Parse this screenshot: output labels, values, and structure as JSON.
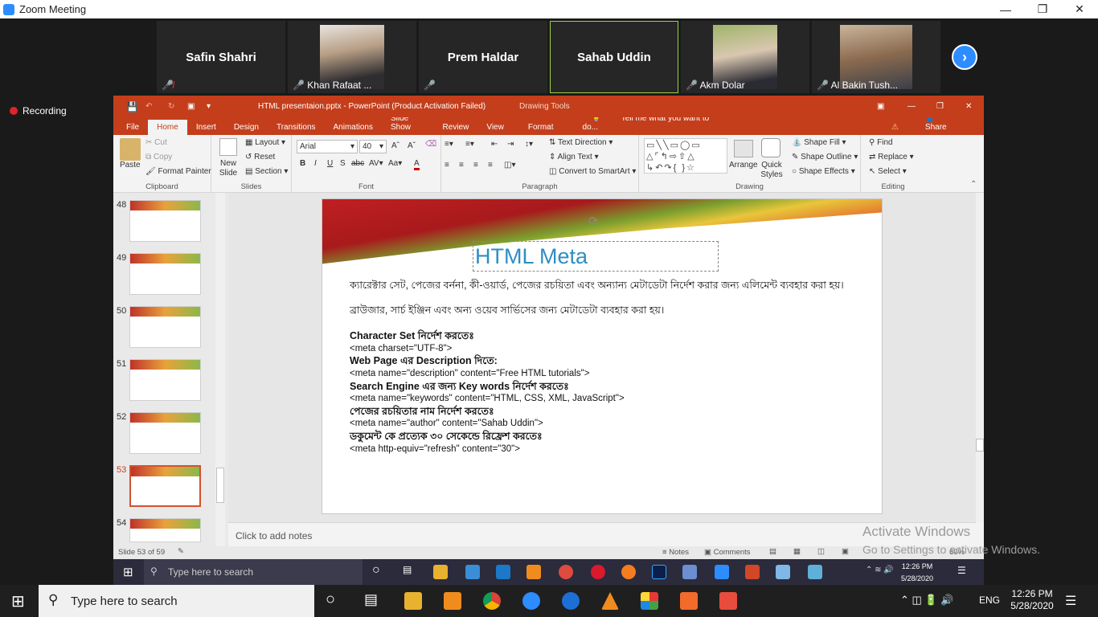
{
  "zoom": {
    "title": "Zoom Meeting",
    "recording": "Recording",
    "next_icon": "chevron-right-icon"
  },
  "participants": [
    {
      "name": "Safin Shahri",
      "video": false
    },
    {
      "name": "Khan Rafaat ...",
      "video": true
    },
    {
      "name": "Prem Haldar",
      "video": false
    },
    {
      "name": "Sahab Uddin",
      "video": false,
      "active": true
    },
    {
      "name": "Akm Dolar",
      "video": true
    },
    {
      "name": "Al Bakin Tush...",
      "video": true
    }
  ],
  "ppt": {
    "title": "HTML presentaion.pptx - PowerPoint (Product Activation Failed)",
    "drawing_tools": "Drawing Tools",
    "tabs": [
      "File",
      "Home",
      "Insert",
      "Design",
      "Transitions",
      "Animations",
      "Slide Show",
      "Review",
      "View",
      "Format"
    ],
    "tell_me": "Tell me what you want to do...",
    "share": "Share",
    "clipboard": {
      "paste": "Paste",
      "cut": "Cut",
      "copy": "Copy",
      "format_painter": "Format Painter",
      "label": "Clipboard"
    },
    "slides_grp": {
      "new_slide": "New Slide",
      "layout": "Layout",
      "reset": "Reset",
      "section": "Section",
      "label": "Slides"
    },
    "font": {
      "name": "Arial",
      "size": "40",
      "label": "Font"
    },
    "paragraph": {
      "text_direction": "Text Direction",
      "align_text": "Align Text",
      "convert": "Convert to SmartArt",
      "label": "Paragraph"
    },
    "drawing": {
      "arrange": "Arrange",
      "quick_styles": "Quick Styles",
      "shape_fill": "Shape Fill",
      "shape_outline": "Shape Outline",
      "shape_effects": "Shape Effects",
      "label": "Drawing"
    },
    "editing": {
      "find": "Find",
      "replace": "Replace",
      "select": "Select",
      "label": "Editing"
    },
    "thumbnails": [
      48,
      49,
      50,
      51,
      52,
      53,
      54
    ],
    "selected_slide": 53,
    "slide": {
      "title": "HTML Meta",
      "p1": "ক্যারেক্টার সেট, পেজের বর্ননা, কী-ওয়ার্ড, পেজের রচয়িতা এবং অন্যান্য মেটাডেটা নির্দেশ করার জন্য এলিমেন্ট ব্যবহার করা হয়।",
      "p2": "ব্রাউজার, সার্চ ইঞ্জিন এবং অন্য ওয়েব সার্ভিসের জন্য মেটাডেটা ব্যবহার করা হয়।",
      "lines": [
        {
          "t": "Character Set নির্দেশ করতেঃ",
          "bold": true
        },
        {
          "t": "<meta charset=\"UTF-8\">",
          "bold": false
        },
        {
          "t": "Web Page এর Description দিতে:",
          "bold": true
        },
        {
          "t": "<meta name=\"description\" content=\"Free HTML tutorials\">",
          "bold": false
        },
        {
          "t": "Search Engine এর জন্য Key words নির্দেশ করতেঃ",
          "bold": true
        },
        {
          "t": "<meta name=\"keywords\" content=\"HTML, CSS, XML, JavaScript\">",
          "bold": false
        },
        {
          "t": "পেজের রচয়িতার নাম নির্দেশ করতেঃ",
          "bold": true
        },
        {
          "t": "<meta name=\"author\" content=\"Sahab Uddin\">",
          "bold": false
        },
        {
          "t": "ডকুমেন্ট কে প্রত্যেক ৩০ সেকেন্ডে রিফ্রেশ করতেঃ",
          "bold": true
        },
        {
          "t": "<meta http-equiv=\"refresh\" content=\"30\">",
          "bold": false
        }
      ]
    },
    "notes_placeholder": "Click to add notes",
    "status": {
      "slide": "Slide 53 of 59",
      "notes": "Notes",
      "comments": "Comments",
      "zoom": "69%"
    }
  },
  "watermark": {
    "line1": "Activate Windows",
    "line2": "Go to Settings to activate Windows."
  },
  "inner_taskbar": {
    "search": "Type here to search",
    "time": "12:26 PM",
    "date": "5/28/2020"
  },
  "taskbar": {
    "search": "Type here to search",
    "lang": "ENG",
    "time": "12:26 PM",
    "date": "5/28/2020"
  }
}
